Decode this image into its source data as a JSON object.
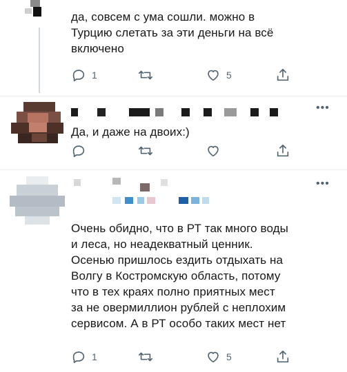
{
  "tweets": [
    {
      "text_lines": [
        "да, совсем с ума сошли. можно в",
        "Турцию слетать за эти деньги на всё",
        "включено"
      ],
      "replies": "1",
      "likes": "5"
    },
    {
      "text_lines": [
        "Да, и даже на двоих:)"
      ],
      "more": "•••",
      "replies": "",
      "likes": ""
    },
    {
      "text_lines": [
        "Очень обидно, что в РТ так много воды",
        "и леса, но неадекватный ценник.",
        "Осенью пришлось ездить отдыхать на",
        "Волгу в Костромскую область, потому",
        "что в тех краях полно приятных мест",
        "за не овермиллион рублей с неплохим",
        "сервисом. А в РТ особо таких мест нет"
      ],
      "more": "•••",
      "replies": "1",
      "likes": "5"
    }
  ],
  "icons": {
    "reply": "reply-icon",
    "retweet": "retweet-icon",
    "like": "heart-icon",
    "share": "share-icon"
  },
  "colors": {
    "icon": "#536471",
    "divider": "#e6ecf0",
    "text": "#171717"
  }
}
